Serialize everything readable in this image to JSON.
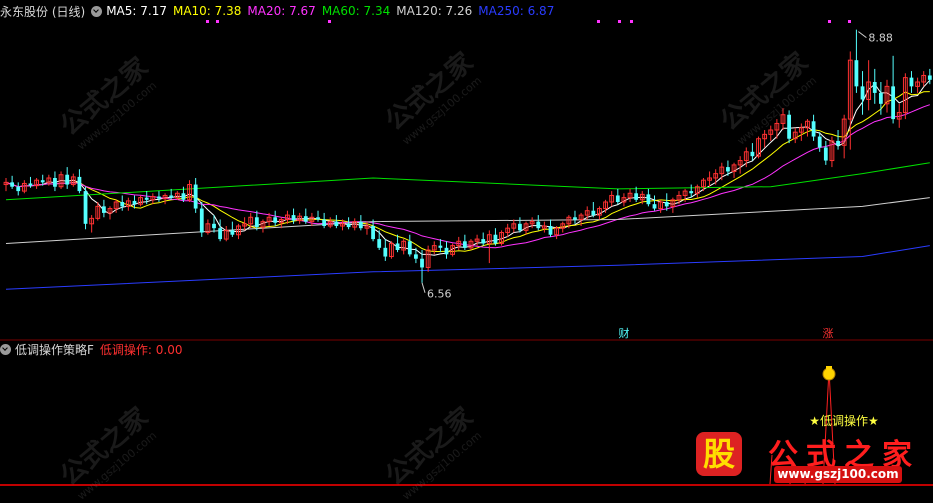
{
  "header": {
    "stock": "永东股份 (日线)",
    "ma": [
      {
        "label": "MA5: 7.17",
        "color": "#ffffff"
      },
      {
        "label": "MA10: 7.38",
        "color": "#ffff00"
      },
      {
        "label": "MA20: 7.67",
        "color": "#ff33ff"
      },
      {
        "label": "MA60: 7.34",
        "color": "#00e000"
      },
      {
        "label": "MA120: 7.26",
        "color": "#d0d0d0"
      },
      {
        "label": "MA250: 6.87",
        "color": "#2a3cff"
      }
    ]
  },
  "indicator": {
    "name": "低调操作策略F",
    "value_label": "低调操作: 0.00",
    "signal_label": "★低调操作★"
  },
  "markers": {
    "cai": "财",
    "zhang": "涨"
  },
  "watermark": {
    "text": "公式之家",
    "url": "www.gszj100.com"
  },
  "logo": {
    "glyph": "股",
    "title": "公式之家",
    "url": "www.gszj100.com"
  },
  "colors": {
    "up": "#ff3232",
    "down": "#54ffff",
    "indicator_line": "#ff2020",
    "bottom_line": "#c00000"
  },
  "chart_data": {
    "type": "candlestick",
    "ylim": [
      6.2,
      8.95
    ],
    "annotations": [
      {
        "text": "8.88",
        "kind": "high",
        "index": 139
      },
      {
        "text": "6.56",
        "kind": "low",
        "index": 68
      }
    ],
    "ohlc": [
      [
        7.46,
        7.52,
        7.4,
        7.48
      ],
      [
        7.48,
        7.54,
        7.42,
        7.44
      ],
      [
        7.44,
        7.48,
        7.36,
        7.4
      ],
      [
        7.4,
        7.5,
        7.38,
        7.47
      ],
      [
        7.47,
        7.53,
        7.43,
        7.45
      ],
      [
        7.45,
        7.52,
        7.42,
        7.5
      ],
      [
        7.5,
        7.55,
        7.45,
        7.48
      ],
      [
        7.48,
        7.55,
        7.45,
        7.52
      ],
      [
        7.52,
        7.58,
        7.4,
        7.44
      ],
      [
        7.44,
        7.58,
        7.42,
        7.55
      ],
      [
        7.55,
        7.62,
        7.42,
        7.46
      ],
      [
        7.46,
        7.56,
        7.44,
        7.53
      ],
      [
        7.53,
        7.6,
        7.38,
        7.4
      ],
      [
        7.4,
        7.44,
        7.05,
        7.1
      ],
      [
        7.1,
        7.18,
        7.02,
        7.15
      ],
      [
        7.15,
        7.3,
        7.13,
        7.26
      ],
      [
        7.26,
        7.32,
        7.16,
        7.2
      ],
      [
        7.2,
        7.26,
        7.14,
        7.24
      ],
      [
        7.24,
        7.32,
        7.2,
        7.3
      ],
      [
        7.3,
        7.36,
        7.22,
        7.26
      ],
      [
        7.26,
        7.34,
        7.22,
        7.31
      ],
      [
        7.31,
        7.36,
        7.24,
        7.28
      ],
      [
        7.28,
        7.36,
        7.26,
        7.34
      ],
      [
        7.34,
        7.4,
        7.28,
        7.32
      ],
      [
        7.32,
        7.38,
        7.28,
        7.35
      ],
      [
        7.35,
        7.4,
        7.3,
        7.33
      ],
      [
        7.33,
        7.38,
        7.28,
        7.36
      ],
      [
        7.36,
        7.42,
        7.32,
        7.34
      ],
      [
        7.34,
        7.4,
        7.32,
        7.38
      ],
      [
        7.38,
        7.44,
        7.3,
        7.32
      ],
      [
        7.32,
        7.5,
        7.3,
        7.46
      ],
      [
        7.46,
        7.52,
        7.2,
        7.24
      ],
      [
        7.24,
        7.3,
        6.98,
        7.02
      ],
      [
        7.02,
        7.14,
        7.0,
        7.1
      ],
      [
        7.1,
        7.18,
        7.02,
        7.06
      ],
      [
        7.06,
        7.14,
        6.94,
        6.96
      ],
      [
        6.96,
        7.08,
        6.94,
        7.04
      ],
      [
        7.04,
        7.12,
        6.98,
        7.0
      ],
      [
        7.0,
        7.1,
        6.96,
        7.08
      ],
      [
        7.08,
        7.16,
        7.04,
        7.1
      ],
      [
        7.1,
        7.2,
        7.06,
        7.16
      ],
      [
        7.16,
        7.22,
        7.04,
        7.07
      ],
      [
        7.07,
        7.14,
        7.02,
        7.12
      ],
      [
        7.12,
        7.2,
        7.08,
        7.16
      ],
      [
        7.16,
        7.22,
        7.08,
        7.11
      ],
      [
        7.11,
        7.16,
        7.06,
        7.14
      ],
      [
        7.14,
        7.22,
        7.1,
        7.18
      ],
      [
        7.18,
        7.24,
        7.1,
        7.13
      ],
      [
        7.13,
        7.2,
        7.1,
        7.17
      ],
      [
        7.17,
        7.24,
        7.1,
        7.12
      ],
      [
        7.12,
        7.2,
        7.08,
        7.16
      ],
      [
        7.16,
        7.22,
        7.12,
        7.14
      ],
      [
        7.14,
        7.2,
        7.06,
        7.08
      ],
      [
        7.08,
        7.16,
        7.06,
        7.12
      ],
      [
        7.12,
        7.18,
        7.06,
        7.08
      ],
      [
        7.08,
        7.14,
        7.04,
        7.1
      ],
      [
        7.1,
        7.16,
        7.05,
        7.07
      ],
      [
        7.07,
        7.15,
        7.04,
        7.12
      ],
      [
        7.12,
        7.18,
        7.04,
        7.06
      ],
      [
        7.06,
        7.12,
        7.0,
        7.08
      ],
      [
        7.08,
        7.14,
        6.94,
        6.96
      ],
      [
        6.96,
        7.04,
        6.86,
        6.88
      ],
      [
        6.88,
        6.96,
        6.76,
        6.8
      ],
      [
        6.8,
        6.94,
        6.78,
        6.92
      ],
      [
        6.92,
        7.0,
        6.84,
        6.86
      ],
      [
        6.86,
        6.96,
        6.82,
        6.94
      ],
      [
        6.94,
        7.0,
        6.8,
        6.82
      ],
      [
        6.82,
        6.88,
        6.74,
        6.78
      ],
      [
        6.78,
        6.86,
        6.56,
        6.7
      ],
      [
        6.7,
        6.9,
        6.66,
        6.86
      ],
      [
        6.86,
        6.94,
        6.82,
        6.9
      ],
      [
        6.9,
        6.96,
        6.84,
        6.88
      ],
      [
        6.88,
        6.94,
        6.78,
        6.82
      ],
      [
        6.82,
        6.92,
        6.8,
        6.9
      ],
      [
        6.9,
        6.98,
        6.86,
        6.94
      ],
      [
        6.94,
        7.0,
        6.86,
        6.88
      ],
      [
        6.88,
        6.96,
        6.86,
        6.94
      ],
      [
        6.94,
        7.0,
        6.9,
        6.96
      ],
      [
        6.96,
        7.02,
        6.9,
        6.92
      ],
      [
        6.92,
        7.04,
        6.74,
        7.0
      ],
      [
        7.0,
        7.06,
        6.9,
        6.92
      ],
      [
        6.92,
        7.04,
        6.9,
        7.02
      ],
      [
        7.02,
        7.1,
        6.98,
        7.06
      ],
      [
        7.06,
        7.14,
        7.02,
        7.1
      ],
      [
        7.1,
        7.16,
        7.02,
        7.04
      ],
      [
        7.04,
        7.12,
        7.0,
        7.1
      ],
      [
        7.1,
        7.16,
        7.06,
        7.12
      ],
      [
        7.12,
        7.18,
        7.04,
        7.06
      ],
      [
        7.06,
        7.12,
        7.02,
        7.08
      ],
      [
        7.08,
        7.14,
        6.98,
        7.0
      ],
      [
        7.0,
        7.08,
        6.96,
        7.06
      ],
      [
        7.06,
        7.12,
        7.02,
        7.1
      ],
      [
        7.1,
        7.18,
        7.06,
        7.16
      ],
      [
        7.16,
        7.22,
        7.1,
        7.14
      ],
      [
        7.14,
        7.2,
        7.08,
        7.18
      ],
      [
        7.18,
        7.26,
        7.14,
        7.22
      ],
      [
        7.22,
        7.3,
        7.16,
        7.18
      ],
      [
        7.18,
        7.26,
        7.14,
        7.24
      ],
      [
        7.24,
        7.32,
        7.2,
        7.3
      ],
      [
        7.3,
        7.4,
        7.26,
        7.36
      ],
      [
        7.36,
        7.42,
        7.28,
        7.3
      ],
      [
        7.3,
        7.38,
        7.26,
        7.34
      ],
      [
        7.34,
        7.42,
        7.3,
        7.38
      ],
      [
        7.38,
        7.44,
        7.3,
        7.32
      ],
      [
        7.32,
        7.4,
        7.28,
        7.37
      ],
      [
        7.37,
        7.42,
        7.26,
        7.28
      ],
      [
        7.28,
        7.36,
        7.22,
        7.24
      ],
      [
        7.24,
        7.32,
        7.2,
        7.3
      ],
      [
        7.3,
        7.38,
        7.22,
        7.26
      ],
      [
        7.26,
        7.34,
        7.2,
        7.32
      ],
      [
        7.32,
        7.4,
        7.28,
        7.36
      ],
      [
        7.36,
        7.42,
        7.3,
        7.4
      ],
      [
        7.4,
        7.46,
        7.34,
        7.38
      ],
      [
        7.38,
        7.46,
        7.34,
        7.44
      ],
      [
        7.44,
        7.52,
        7.4,
        7.5
      ],
      [
        7.5,
        7.58,
        7.44,
        7.52
      ],
      [
        7.52,
        7.6,
        7.46,
        7.56
      ],
      [
        7.56,
        7.66,
        7.5,
        7.62
      ],
      [
        7.62,
        7.68,
        7.54,
        7.58
      ],
      [
        7.58,
        7.66,
        7.52,
        7.64
      ],
      [
        7.64,
        7.72,
        7.56,
        7.68
      ],
      [
        7.68,
        7.8,
        7.62,
        7.76
      ],
      [
        7.76,
        7.84,
        7.68,
        7.72
      ],
      [
        7.72,
        7.9,
        7.7,
        7.88
      ],
      [
        7.88,
        7.96,
        7.8,
        7.92
      ],
      [
        7.92,
        8.0,
        7.86,
        7.96
      ],
      [
        7.96,
        8.06,
        7.88,
        8.02
      ],
      [
        8.02,
        8.16,
        7.96,
        8.1
      ],
      [
        8.1,
        8.14,
        7.84,
        7.88
      ],
      [
        7.88,
        7.98,
        7.84,
        7.94
      ],
      [
        7.94,
        8.02,
        7.86,
        7.98
      ],
      [
        7.98,
        8.06,
        7.9,
        8.04
      ],
      [
        8.04,
        8.1,
        7.86,
        7.9
      ],
      [
        7.9,
        7.94,
        7.76,
        7.8
      ],
      [
        7.8,
        7.86,
        7.64,
        7.68
      ],
      [
        7.68,
        7.9,
        7.62,
        7.86
      ],
      [
        7.86,
        7.96,
        7.78,
        7.82
      ],
      [
        7.82,
        8.1,
        7.7,
        8.06
      ],
      [
        8.06,
        8.68,
        7.78,
        8.6
      ],
      [
        8.6,
        8.88,
        8.3,
        8.36
      ],
      [
        8.36,
        8.5,
        8.1,
        8.24
      ],
      [
        8.24,
        8.6,
        8.14,
        8.4
      ],
      [
        8.4,
        8.52,
        8.2,
        8.3
      ],
      [
        8.3,
        8.4,
        8.1,
        8.2
      ],
      [
        8.2,
        8.42,
        8.12,
        8.36
      ],
      [
        8.36,
        8.64,
        8.02,
        8.06
      ],
      [
        8.06,
        8.2,
        7.98,
        8.12
      ],
      [
        8.12,
        8.48,
        8.06,
        8.44
      ],
      [
        8.44,
        8.5,
        8.3,
        8.36
      ],
      [
        8.36,
        8.44,
        8.3,
        8.4
      ],
      [
        8.4,
        8.5,
        8.36,
        8.46
      ],
      [
        8.46,
        8.52,
        8.38,
        8.42
      ]
    ]
  }
}
